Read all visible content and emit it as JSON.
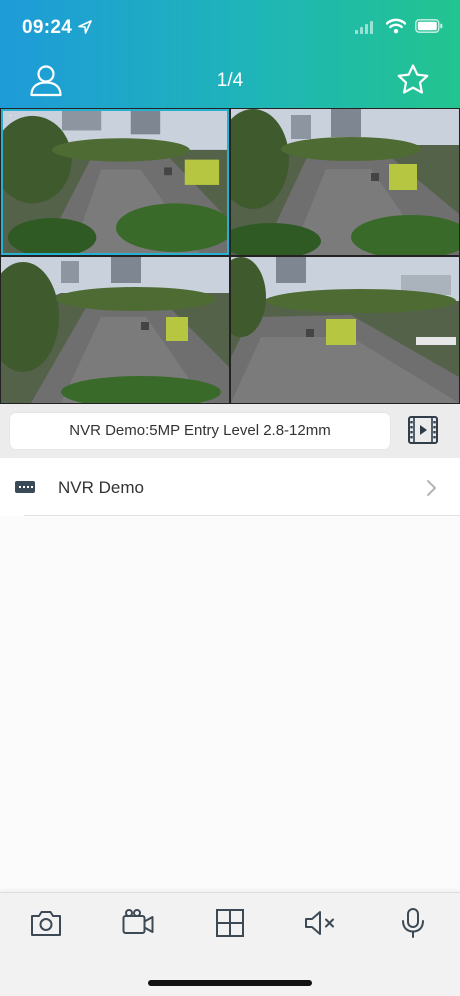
{
  "status_bar": {
    "time": "09:24"
  },
  "header": {
    "page_indicator": "1/4",
    "user_icon": "user-icon",
    "favorite_icon": "star-icon",
    "gradient_start": "#1e9bd9",
    "gradient_end": "#22c48f"
  },
  "cameras": [
    {
      "selected": true
    },
    {
      "selected": false
    },
    {
      "selected": false
    },
    {
      "selected": false
    }
  ],
  "channel": {
    "label": "NVR Demo:5MP Entry Level 2.8-12mm",
    "playback_icon": "film-play-icon"
  },
  "devices": [
    {
      "name": "NVR Demo",
      "icon": "nvr-device-icon"
    }
  ],
  "toolbar": {
    "items": [
      "camera-snapshot-icon",
      "video-record-icon",
      "grid-layout-icon",
      "speaker-mute-icon",
      "microphone-icon"
    ]
  }
}
